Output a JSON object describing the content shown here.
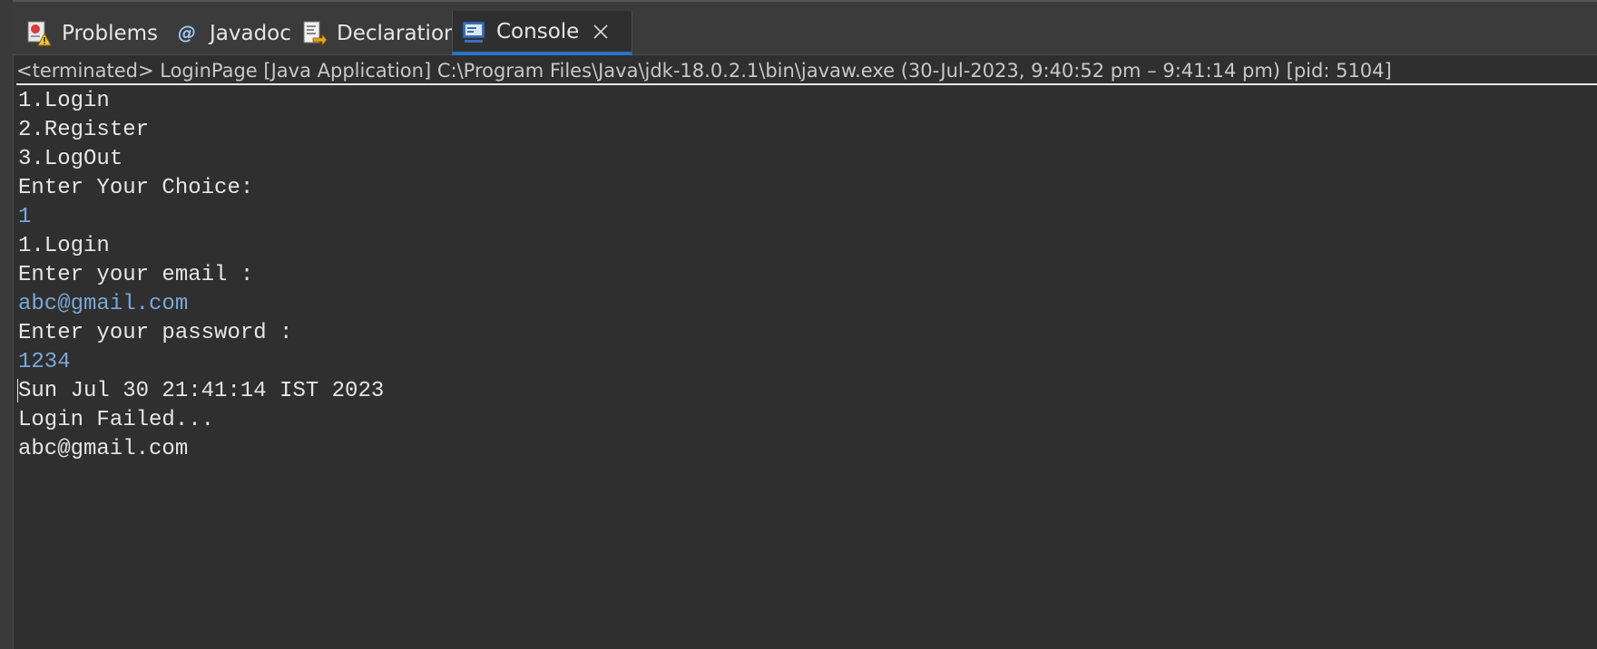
{
  "tabs": [
    {
      "label": "Problems",
      "icon": "problems-icon"
    },
    {
      "label": "Javadoc",
      "icon": "javadoc-icon"
    },
    {
      "label": "Declaration",
      "icon": "declaration-icon"
    },
    {
      "label": "Console",
      "icon": "console-icon",
      "active": true
    }
  ],
  "status_line": "<terminated> LoginPage [Java Application] C:\\Program Files\\Java\\jdk-18.0.2.1\\bin\\javaw.exe  (30-Jul-2023, 9:40:52 pm – 9:41:14 pm) [pid: 5104]",
  "console": {
    "lines": [
      {
        "text": "1.Login",
        "type": "output"
      },
      {
        "text": "2.Register",
        "type": "output"
      },
      {
        "text": "3.LogOut",
        "type": "output"
      },
      {
        "text": "Enter Your Choice:",
        "type": "output"
      },
      {
        "text": "1",
        "type": "input"
      },
      {
        "text": "1.Login",
        "type": "output"
      },
      {
        "text": "Enter your email :",
        "type": "output"
      },
      {
        "text": "abc@gmail.com",
        "type": "input"
      },
      {
        "text": "Enter your password :",
        "type": "output"
      },
      {
        "text": "1234",
        "type": "input"
      },
      {
        "text": "Sun Jul 30 21:41:14 IST 2023",
        "type": "output"
      },
      {
        "text": "Login Failed...",
        "type": "output"
      },
      {
        "text": "abc@gmail.com",
        "type": "output"
      }
    ]
  },
  "colors": {
    "background": "#2f2f2f",
    "output_text": "#e6e6e6",
    "input_text": "#7ba7d7",
    "active_tab_underline": "#2a73c7"
  }
}
